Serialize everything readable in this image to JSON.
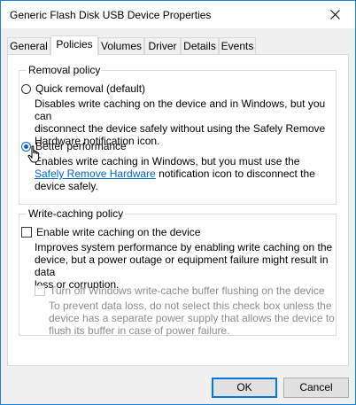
{
  "window": {
    "title": "Generic Flash Disk USB Device Properties"
  },
  "tabs": [
    {
      "label": "General"
    },
    {
      "label": "Policies"
    },
    {
      "label": "Volumes"
    },
    {
      "label": "Driver"
    },
    {
      "label": "Details"
    },
    {
      "label": "Events"
    }
  ],
  "active_tab": "Policies",
  "removal_policy": {
    "title": "Removal policy",
    "quick": {
      "label": "Quick removal (default)",
      "checked": false,
      "desc_lines": [
        "Disables write caching on the device and in Windows, but you can",
        "disconnect the device safely without using the Safely Remove",
        "Hardware notification icon."
      ]
    },
    "better": {
      "label": "Better performance",
      "checked": true,
      "desc_line1": "Enables write caching in Windows, but you must use the",
      "desc_link": "Safely Remove Hardware",
      "desc_after_link": " notification icon to disconnect the",
      "desc_line3": "device safely."
    }
  },
  "write_caching": {
    "title": "Write-caching policy",
    "enable": {
      "label": "Enable write caching on the device",
      "checked": false,
      "desc_lines": [
        "Improves system performance by enabling write caching on the",
        "device, but a power outage or equipment failure might result in data",
        "loss or corruption."
      ]
    },
    "turn_off": {
      "label": "Turn off Windows write-cache buffer flushing on the device",
      "checked": false,
      "disabled": true,
      "desc_lines": [
        "To prevent data loss, do not select this check box unless the",
        "device has a separate power supply that allows the device to",
        "flush its buffer in case of power failure."
      ]
    }
  },
  "buttons": {
    "ok": "OK",
    "cancel": "Cancel"
  },
  "colors": {
    "accent": "#0078d7",
    "link": "#0066cc",
    "disabled_text": "#8c8c8c"
  }
}
